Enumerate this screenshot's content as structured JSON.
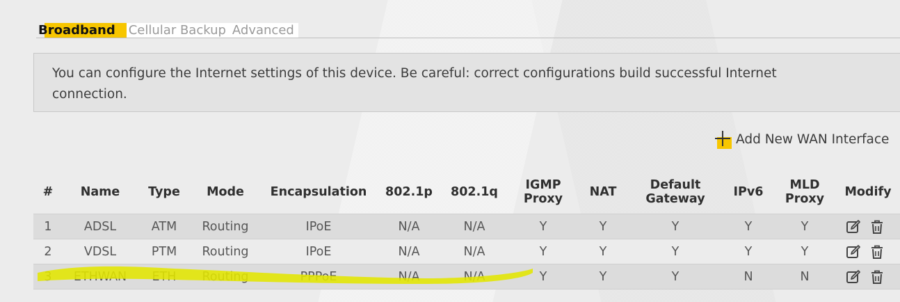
{
  "tabs": [
    {
      "label": "Broadband",
      "active": true
    },
    {
      "label": "Cellular Backup",
      "active": false
    },
    {
      "label": "Advanced",
      "active": false
    }
  ],
  "info_text": "You can configure the Internet settings of this device. Be careful: correct configurations build successful Internet connection.",
  "add_wan_label": "Add New WAN Interface",
  "accent_color": "#f7c600",
  "highlight_color": "#e3e600",
  "table": {
    "headers": [
      "#",
      "Name",
      "Type",
      "Mode",
      "Encapsulation",
      "802.1p",
      "802.1q",
      "IGMP Proxy",
      "NAT",
      "Default Gateway",
      "IPv6",
      "MLD Proxy",
      "Modify"
    ],
    "rows": [
      [
        "1",
        "ADSL",
        "ATM",
        "Routing",
        "IPoE",
        "N/A",
        "N/A",
        "Y",
        "Y",
        "Y",
        "Y",
        "Y"
      ],
      [
        "2",
        "VDSL",
        "PTM",
        "Routing",
        "IPoE",
        "N/A",
        "N/A",
        "Y",
        "Y",
        "Y",
        "Y",
        "Y"
      ],
      [
        "3",
        "ETHWAN",
        "ETH",
        "Routing",
        "PPPoE",
        "N/A",
        "N/A",
        "Y",
        "Y",
        "Y",
        "N",
        "N"
      ]
    ],
    "modify_icons": [
      "edit-icon",
      "trash-icon"
    ]
  }
}
